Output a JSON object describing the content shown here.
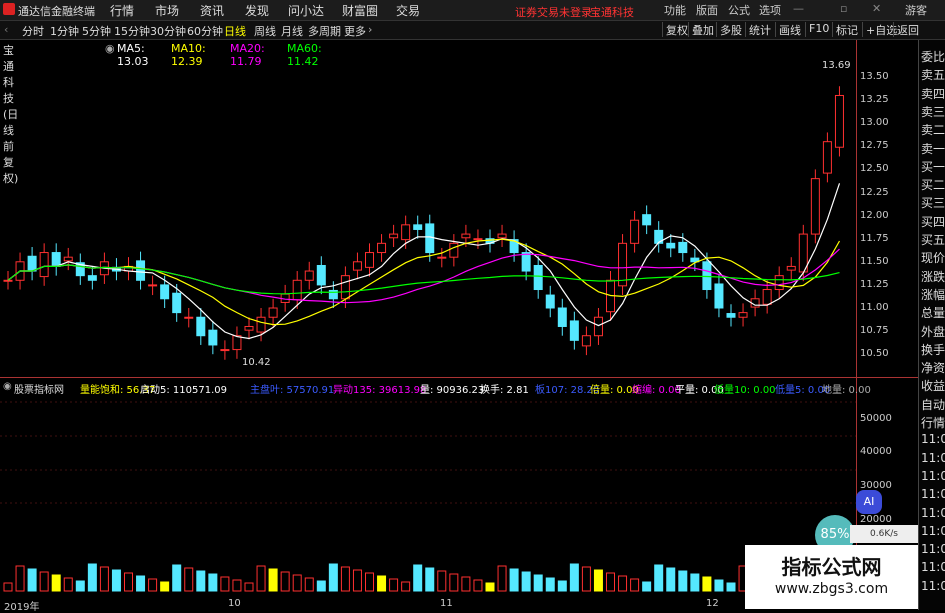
{
  "titlebar": {
    "app_name": "通达信金融终端",
    "menus": [
      "行情",
      "市场",
      "资讯",
      "发现",
      "问小达",
      "财富圈",
      "交易"
    ],
    "notice": "证券交易未登录",
    "stock_name": "宝通科技",
    "right_buttons": [
      "功能",
      "版面",
      "公式",
      "选项"
    ],
    "user": "游客"
  },
  "toolbar": {
    "periods": [
      "分时",
      "1分钟",
      "5分钟",
      "15分钟",
      "30分钟",
      "60分钟",
      "日线",
      "周线",
      "月线",
      "多周期",
      "更多"
    ],
    "active_period": "日线",
    "right_buttons": [
      "复权",
      "叠加",
      "多股",
      "统计",
      "画线",
      "F10",
      "标记",
      "+自选",
      "返回"
    ]
  },
  "ma_line": {
    "title": "宝通科技(日线 前复权)",
    "ma5": "MA5: 13.03",
    "ma10": "MA10: 12.39",
    "ma20": "MA20: 11.79",
    "ma60": "MA60: 11.42",
    "colors": {
      "ma5": "#ffffff",
      "ma10": "#ffff00",
      "ma20": "#ff00ff",
      "ma60": "#00ff00"
    }
  },
  "price_axis": [
    "13.50",
    "13.25",
    "13.00",
    "12.75",
    "12.50",
    "12.25",
    "12.00",
    "11.75",
    "11.50",
    "11.25",
    "11.00",
    "10.75",
    "10.50"
  ],
  "annotations": {
    "high": "13.69",
    "low": "10.42"
  },
  "indicator_line": {
    "name": "股票指标网",
    "items": [
      {
        "label": "量能饱和: 56.37",
        "color": "#ffff00"
      },
      {
        "label": "启动5: 110571.09",
        "color": "#ffffff"
      },
      {
        "label": "主盘叶: 57570.91",
        "color": "#3b5bff"
      },
      {
        "label": "异动135: 39613.98",
        "color": "#ff00ff"
      },
      {
        "label": "量: 90936.23",
        "color": "#ffffff"
      },
      {
        "label": "换手: 2.81",
        "color": "#ffffff"
      },
      {
        "label": "板107: 28.20",
        "color": "#3b5bff"
      },
      {
        "label": "倍量: 0.00",
        "color": "#ffff00"
      },
      {
        "label": "缩编: 0.00",
        "color": "#ff00ff"
      },
      {
        "label": "平量: 0.00",
        "color": "#ffffff"
      },
      {
        "label": "低量10: 0.00",
        "color": "#00ff00"
      },
      {
        "label": "低量5: 0.00",
        "color": "#3b5bff"
      },
      {
        "label": "地量: 0.00",
        "color": "#aaaaaa"
      }
    ]
  },
  "volume_axis": [
    "50000",
    "40000",
    "30000",
    "20000"
  ],
  "x_labels": [
    "2019年",
    "10",
    "11",
    "12"
  ],
  "sidebar": [
    "委比",
    "卖五",
    "卖四",
    "卖三",
    "卖二",
    "卖一",
    "买一",
    "买二",
    "买三",
    "买四",
    "买五",
    "现价",
    "涨跌",
    "涨幅",
    "总量",
    "外盘",
    "换手",
    "净资",
    "收益",
    "自动",
    "行情",
    "11:0",
    "11:0",
    "11:0",
    "11:0",
    "11:0",
    "11:0",
    "11:0",
    "11:0",
    "11:0"
  ],
  "overlay": {
    "ai": "AI",
    "net_pct": "85%",
    "net_speed": "0.6K/s",
    "watermark_title": "指标公式网",
    "watermark_url": "www.zbgs3.com"
  }
}
